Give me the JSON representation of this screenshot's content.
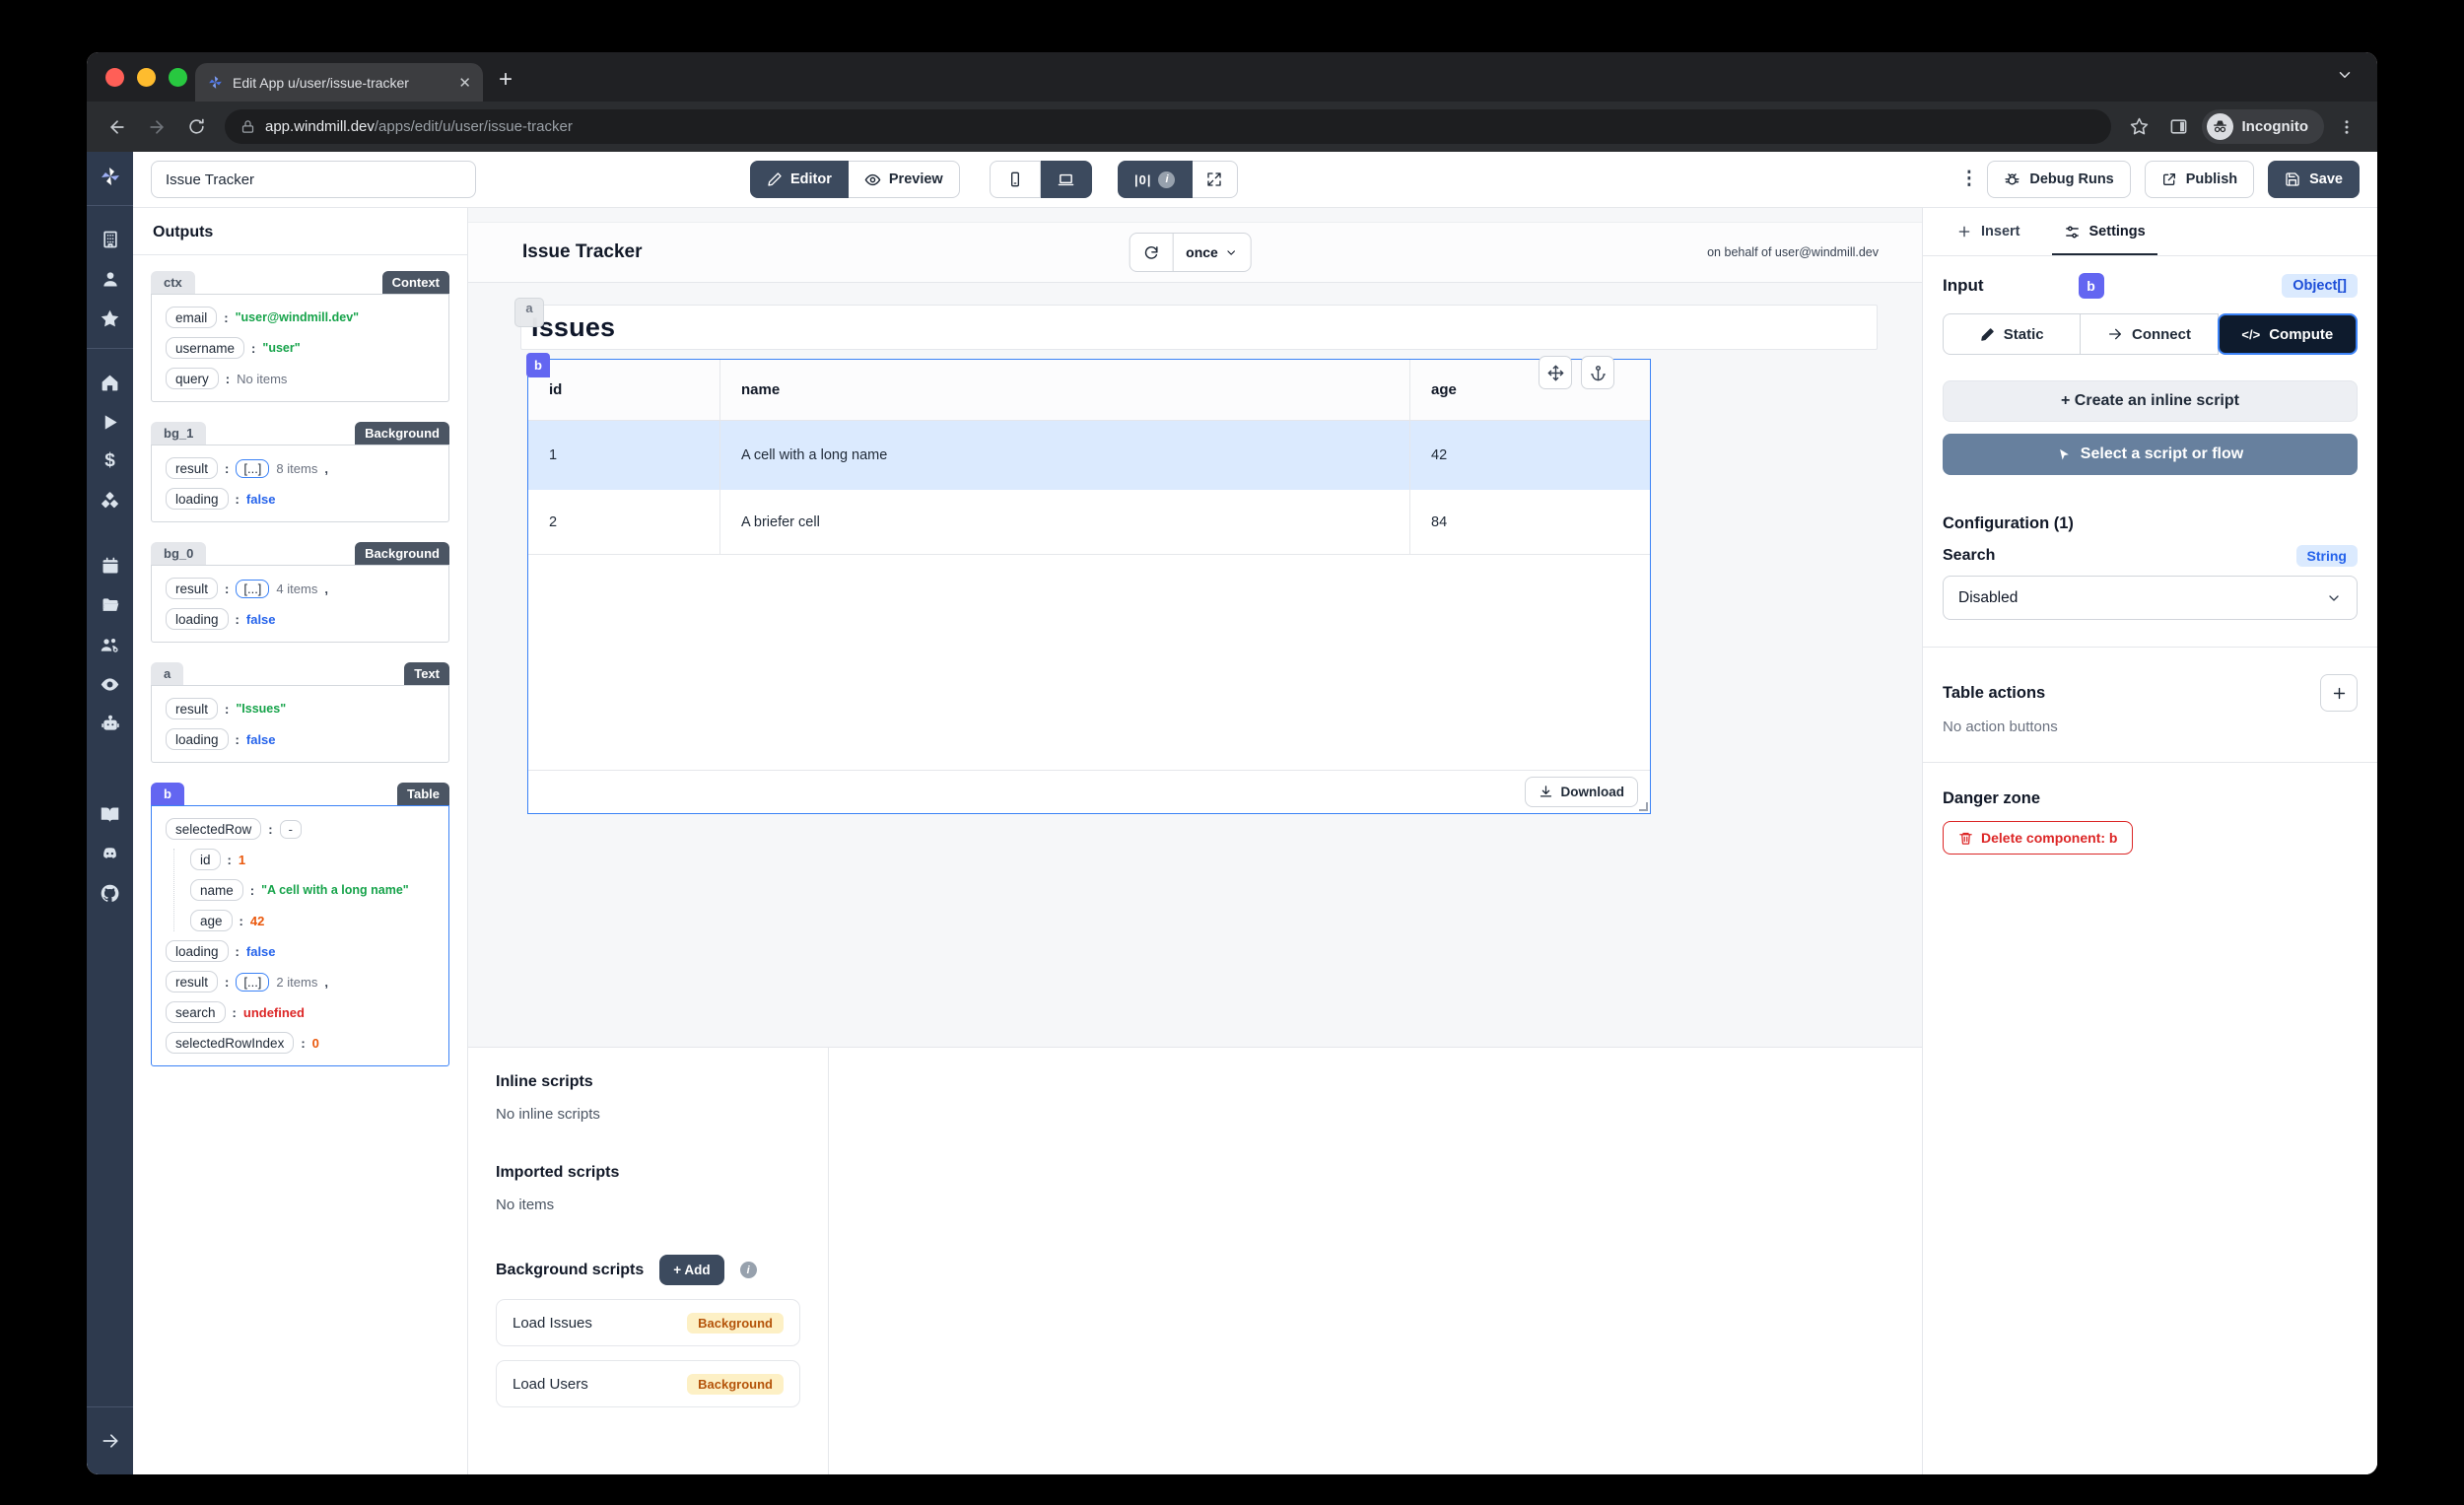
{
  "browser": {
    "tab_title": "Edit App u/user/issue-tracker",
    "url_host": "app.windmill.dev",
    "url_path": "/apps/edit/u/user/issue-tracker",
    "incognito_label": "Incognito"
  },
  "app_toolbar": {
    "app_name": "Issue Tracker",
    "editor": "Editor",
    "preview": "Preview",
    "zero_indicator": "|0|",
    "info_glyph": "i",
    "debug_runs": "Debug Runs",
    "publish": "Publish",
    "save": "Save"
  },
  "outputs": {
    "title": "Outputs",
    "ctx": {
      "name": "ctx",
      "type": "Context",
      "rows": [
        {
          "k": "email",
          "v": "\"user@windmill.dev\""
        },
        {
          "k": "username",
          "v": "\"user\""
        },
        {
          "k": "query",
          "v": "No items"
        }
      ]
    },
    "bg_1": {
      "name": "bg_1",
      "type": "Background",
      "result_key": "result",
      "array_chip": "[...]",
      "items": "8 items",
      "comma": ",",
      "loading_key": "loading",
      "loading_val": "false"
    },
    "bg_0": {
      "name": "bg_0",
      "type": "Background",
      "result_key": "result",
      "array_chip": "[...]",
      "items": "4 items",
      "comma": ",",
      "loading_key": "loading",
      "loading_val": "false"
    },
    "a": {
      "name": "a",
      "type": "Text",
      "result_key": "result",
      "result_val": "\"Issues\"",
      "loading_key": "loading",
      "loading_val": "false"
    },
    "b": {
      "name": "b",
      "type": "Table",
      "selected_row_key": "selectedRow",
      "selected_row_val": "-",
      "id_key": "id",
      "id_val": "1",
      "name_key": "name",
      "name_val": "\"A cell with a long name\"",
      "age_key": "age",
      "age_val": "42",
      "loading_key": "loading",
      "loading_val": "false",
      "result_key": "result",
      "array_chip": "[...]",
      "items": "2 items",
      "comma": ",",
      "search_key": "search",
      "search_val": "undefined",
      "sri_key": "selectedRowIndex",
      "sri_val": "0"
    }
  },
  "canvas": {
    "title": "Issue Tracker",
    "refresh_mode": "once",
    "on_behalf": "on behalf of user@windmill.dev",
    "a_badge": "a",
    "b_badge": "b",
    "heading": "Issues",
    "download": "Download"
  },
  "table": {
    "headers": [
      "id",
      "name",
      "age"
    ],
    "rows": [
      {
        "id": "1",
        "name": "A cell with a long name",
        "age": "42"
      },
      {
        "id": "2",
        "name": "A briefer cell",
        "age": "84"
      }
    ]
  },
  "scripts": {
    "inline_title": "Inline scripts",
    "inline_empty": "No inline scripts",
    "imported_title": "Imported scripts",
    "imported_empty": "No items",
    "background_title": "Background scripts",
    "add": "+ Add",
    "items": [
      {
        "label": "Load Issues",
        "badge": "Background"
      },
      {
        "label": "Load Users",
        "badge": "Background"
      }
    ]
  },
  "settings": {
    "insert_tab": "Insert",
    "settings_tab": "Settings",
    "input_title": "Input",
    "component": "b",
    "type_badge": "Object[]",
    "static": "Static",
    "connect": "Connect",
    "compute": "Compute",
    "code_glyph": "</>",
    "create_inline": "+ Create an inline script",
    "select_script": "Select a script or flow",
    "configuration": "Configuration (1)",
    "search_label": "Search",
    "search_type": "String",
    "search_value": "Disabled",
    "table_actions": "Table actions",
    "no_actions": "No action buttons",
    "danger": "Danger zone",
    "delete_label": "Delete component: b"
  },
  "rail": {
    "dollar": "$"
  },
  "colors": {
    "accent_indigo": "#6366f1",
    "selection_blue": "#3b82f6",
    "string_green": "#16a34a",
    "number_orange": "#ea580c",
    "bool_blue": "#2563eb",
    "error_red": "#dc2626",
    "dark_button": "#3c4a5e",
    "badge_yellow": "#fdf0c5"
  }
}
